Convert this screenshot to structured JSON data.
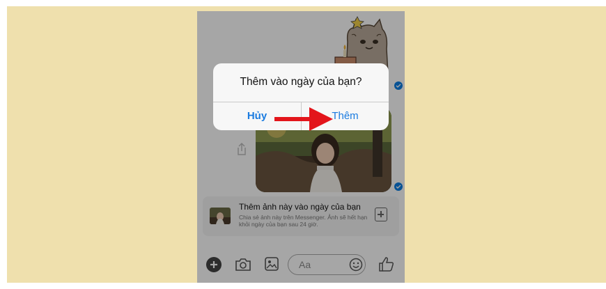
{
  "dialog": {
    "title": "Thêm vào ngày của bạn?",
    "cancel_label": "Hủy",
    "add_label": "Thêm"
  },
  "story_banner": {
    "title": "Thêm ảnh này vào ngày của bạn",
    "subtitle": "Chia sẻ ảnh này trên Messenger. Ảnh sẽ hết hạn khỏi ngày của bạn sau 24 giờ."
  },
  "composer": {
    "placeholder": "Aa"
  },
  "icons": [
    "add-circle-icon",
    "camera-icon",
    "gallery-icon",
    "emoji-icon",
    "like-icon",
    "share-icon",
    "sent-check-icon"
  ],
  "colors": {
    "accent": "#1a7be0",
    "frame_background": "#efe0ad",
    "annotation_arrow": "#e3151b"
  }
}
